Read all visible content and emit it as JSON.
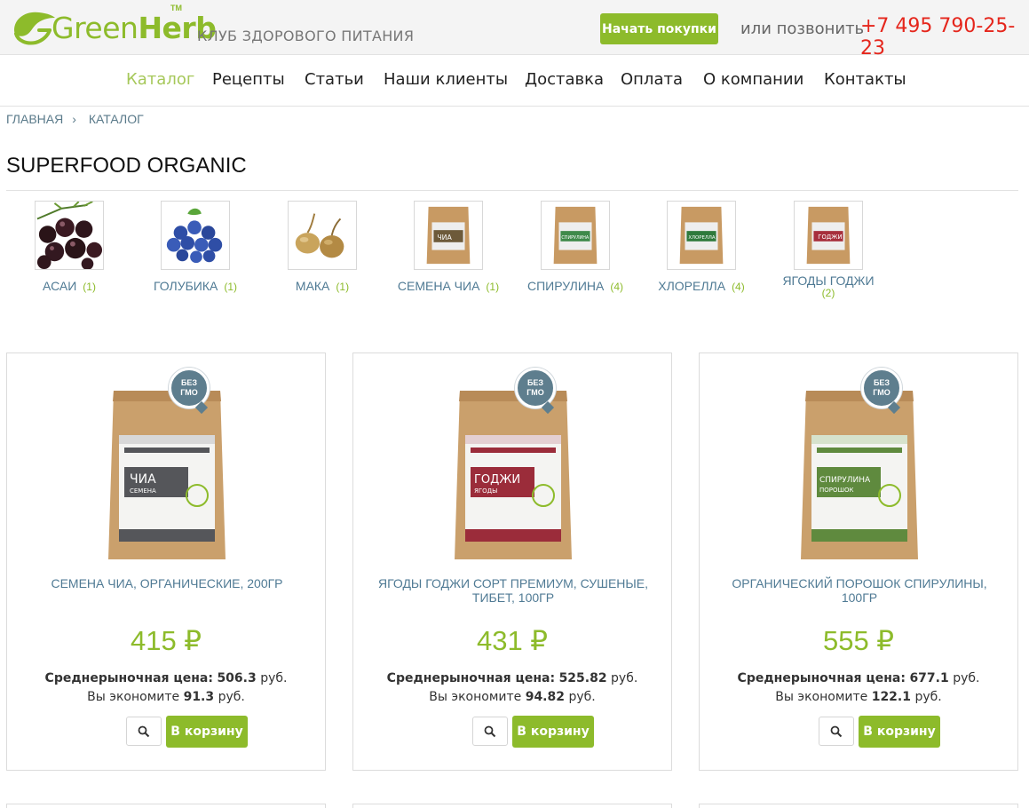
{
  "brand": {
    "logo_green": "Green",
    "logo_herb": "Herb",
    "logo_tm": "TM",
    "tagline": "КЛУБ ЗДОРОВОГО ПИТАНИЯ",
    "accent_color": "#8dbb2b"
  },
  "header": {
    "start_button": "Начать покупки",
    "call_text": "или позвонить",
    "phone": "+7 495 790-25-23",
    "phone_color": "#e5261c"
  },
  "nav": {
    "items": [
      "Каталог",
      "Рецепты",
      "Статьи",
      "Наши клиенты",
      "Доставка",
      "Оплата",
      "О компании",
      "Контакты"
    ],
    "active": "Каталог"
  },
  "breadcrumb": {
    "home": "Главная",
    "separator": "›",
    "current": "Каталог"
  },
  "page_title": "SUPERFOOD ORGANIC",
  "subcategories": [
    {
      "label": "АСАИ",
      "count": "(1)",
      "icon": "acai-berries-image"
    },
    {
      "label": "ГОЛУБИКА",
      "count": "(1)",
      "icon": "blueberries-image"
    },
    {
      "label": "МАКА",
      "count": "(1)",
      "icon": "maca-root-image"
    },
    {
      "label": "СЕМЕНА ЧИА",
      "count": "(1)",
      "icon": "chia-package-image",
      "pack_text": "ЧИА"
    },
    {
      "label": "СПИРУЛИНА",
      "count": "(4)",
      "icon": "spirulina-package-image",
      "pack_text": "СПИРУЛИНА"
    },
    {
      "label": "ХЛОРЕЛЛА",
      "count": "(4)",
      "icon": "chlorella-package-image",
      "pack_text": "ХЛОРЕЛЛА"
    },
    {
      "label": "ЯГОДЫ ГОДЖИ",
      "count": "(2)",
      "icon": "goji-package-image",
      "pack_text": "ГОДЖИ"
    }
  ],
  "products": [
    {
      "badge_line1": "БЕЗ",
      "badge_line2": "ГМО",
      "pack_title": "ЧИА",
      "pack_subtitle": "СЕМЕНА",
      "pack_color": "#55565a",
      "name": "СЕМЕНА ЧИА, ОРГАНИЧЕСКИЕ, 200ГР",
      "price": "415 ₽",
      "market_label": "Среднерыночная цена:",
      "market_value": "506.3",
      "market_unit": "руб.",
      "save_label": "Вы экономите",
      "save_value": "91.3",
      "save_unit": "руб.",
      "cart_label": "В корзину"
    },
    {
      "badge_line1": "БЕЗ",
      "badge_line2": "ГМО",
      "pack_title": "ГОДЖИ",
      "pack_subtitle": "ЯГОДЫ",
      "pack_color": "#9b2c3a",
      "name": "ЯГОДЫ ГОДЖИ СОРТ ПРЕМИУМ, СУШЕНЫЕ, ТИБЕТ, 100ГР",
      "price": "431 ₽",
      "market_label": "Среднерыночная цена:",
      "market_value": "525.82",
      "market_unit": "руб.",
      "save_label": "Вы экономите",
      "save_value": "94.82",
      "save_unit": "руб.",
      "cart_label": "В корзину"
    },
    {
      "badge_line1": "БЕЗ",
      "badge_line2": "ГМО",
      "pack_title": "СПИРУЛИНА",
      "pack_subtitle": "ПОРОШОК",
      "pack_color": "#5f8a3e",
      "name": "ОРГАНИЧЕСКИЙ ПОРОШОК СПИРУЛИНЫ, 100ГР",
      "price": "555 ₽",
      "market_label": "Среднерыночная цена:",
      "market_value": "677.1",
      "market_unit": "руб.",
      "save_label": "Вы экономите",
      "save_value": "122.1",
      "save_unit": "руб.",
      "cart_label": "В корзину"
    }
  ]
}
